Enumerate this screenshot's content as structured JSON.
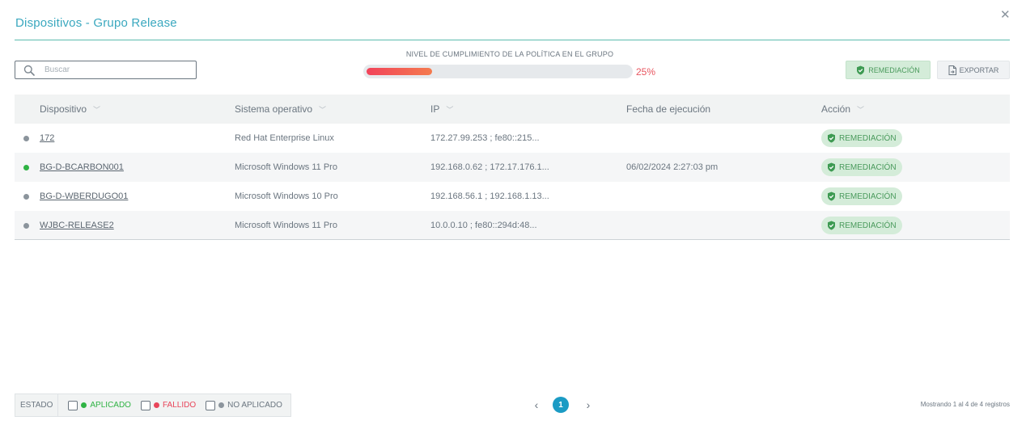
{
  "header": {
    "title": "Dispositivos - Grupo Release",
    "close_glyph": "✕"
  },
  "search": {
    "placeholder": "Buscar"
  },
  "compliance": {
    "label": "NIVEL DE CUMPLIMIENTO DE LA POLÍTICA EN EL GRUPO",
    "value": 25,
    "value_text": "25%"
  },
  "toolbar": {
    "remediation_label": "REMEDIACIÓN",
    "export_label": "EXPORTAR"
  },
  "table": {
    "columns": [
      "Dispositivo",
      "Sistema operativo",
      "IP",
      "Fecha de ejecución",
      "Acción"
    ],
    "rows": [
      {
        "device": "172",
        "os": "Red Hat Enterprise Linux",
        "ip": "172.27.99.253 ; fe80::215...",
        "date": "",
        "action": "REMEDIACIÓN",
        "status_color": "#8b949c"
      },
      {
        "device": "BG-D-BCARBON001",
        "os": "Microsoft Windows 11 Pro",
        "ip": "192.168.0.62 ; 172.17.176.1...",
        "date": "06/02/2024 2:27:03 pm",
        "action": "REMEDIACIÓN",
        "status_color": "#2fb344"
      },
      {
        "device": "BG-D-WBERDUGO01",
        "os": "Microsoft Windows 10 Pro",
        "ip": "192.168.56.1 ; 192.168.1.13...",
        "date": "",
        "action": "REMEDIACIÓN",
        "status_color": "#8b949c"
      },
      {
        "device": "WJBC-RELEASE2",
        "os": "Microsoft Windows 11 Pro",
        "ip": "10.0.0.10 ; fe80::294d:48...",
        "date": "",
        "action": "REMEDIACIÓN",
        "status_color": "#8b949c"
      }
    ]
  },
  "legend": {
    "label": "ESTADO",
    "items": [
      {
        "label": "APLICADO",
        "color": "#2fb344"
      },
      {
        "label": "FALLIDO",
        "color": "#e8455a"
      },
      {
        "label": "NO APLICADO",
        "color": "#8b949c"
      }
    ]
  },
  "pagination": {
    "current_page": "1",
    "prev_glyph": "‹",
    "next_glyph": "›"
  },
  "footer": {
    "showing_text": "Mostrando 1 al 4 de 4 registros"
  },
  "colors": {
    "accent": "#3aa8bf",
    "success": "#2fb344",
    "danger": "#e8455a",
    "page_active": "#1b9bc4"
  }
}
